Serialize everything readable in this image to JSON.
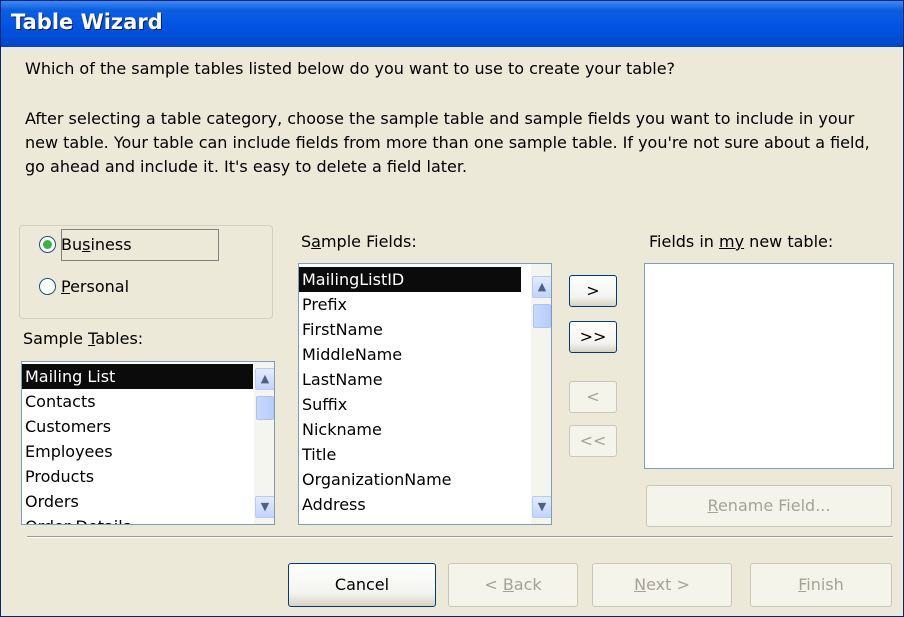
{
  "window": {
    "title": "Table Wizard"
  },
  "intro": {
    "question": "Which of the sample tables listed below do you want to use to create your table?",
    "instructions": "After selecting a table category, choose the sample table and sample fields you want to include in your new table. Your table can include fields from more than one sample table. If you're not sure about a field, go ahead and include it. It's easy to delete a field later."
  },
  "category": {
    "selected": "Business",
    "options": [
      {
        "pre": "Bu",
        "key": "s",
        "post": "iness"
      },
      {
        "pre": "",
        "key": "P",
        "post": "ersonal"
      }
    ]
  },
  "sample_tables": {
    "label_pre": "Sample ",
    "label_key": "T",
    "label_post": "ables:",
    "items": [
      "Mailing List",
      "Contacts",
      "Customers",
      "Employees",
      "Products",
      "Orders",
      "Order Details"
    ],
    "selected_index": 0
  },
  "sample_fields": {
    "label_pre": "S",
    "label_key": "a",
    "label_post": "mple Fields:",
    "items": [
      "MailingListID",
      "Prefix",
      "FirstName",
      "MiddleName",
      "LastName",
      "Suffix",
      "Nickname",
      "Title",
      "OrganizationName",
      "Address"
    ],
    "selected_index": 0
  },
  "new_fields": {
    "label_pre": "Fields in ",
    "label_key": "my",
    "label_post": " new table:",
    "items": []
  },
  "move_buttons": {
    "add_one": ">",
    "add_all": ">>",
    "remove_one": "<",
    "remove_all": "<<"
  },
  "rename_button": {
    "pre": "",
    "key": "R",
    "post": "ename Field..."
  },
  "footer": {
    "cancel": "Cancel",
    "back": {
      "pre": "< ",
      "key": "B",
      "post": "ack"
    },
    "next": {
      "pre": "",
      "key": "N",
      "post": "ext >"
    },
    "finish": {
      "pre": "",
      "key": "F",
      "post": "inish"
    }
  }
}
